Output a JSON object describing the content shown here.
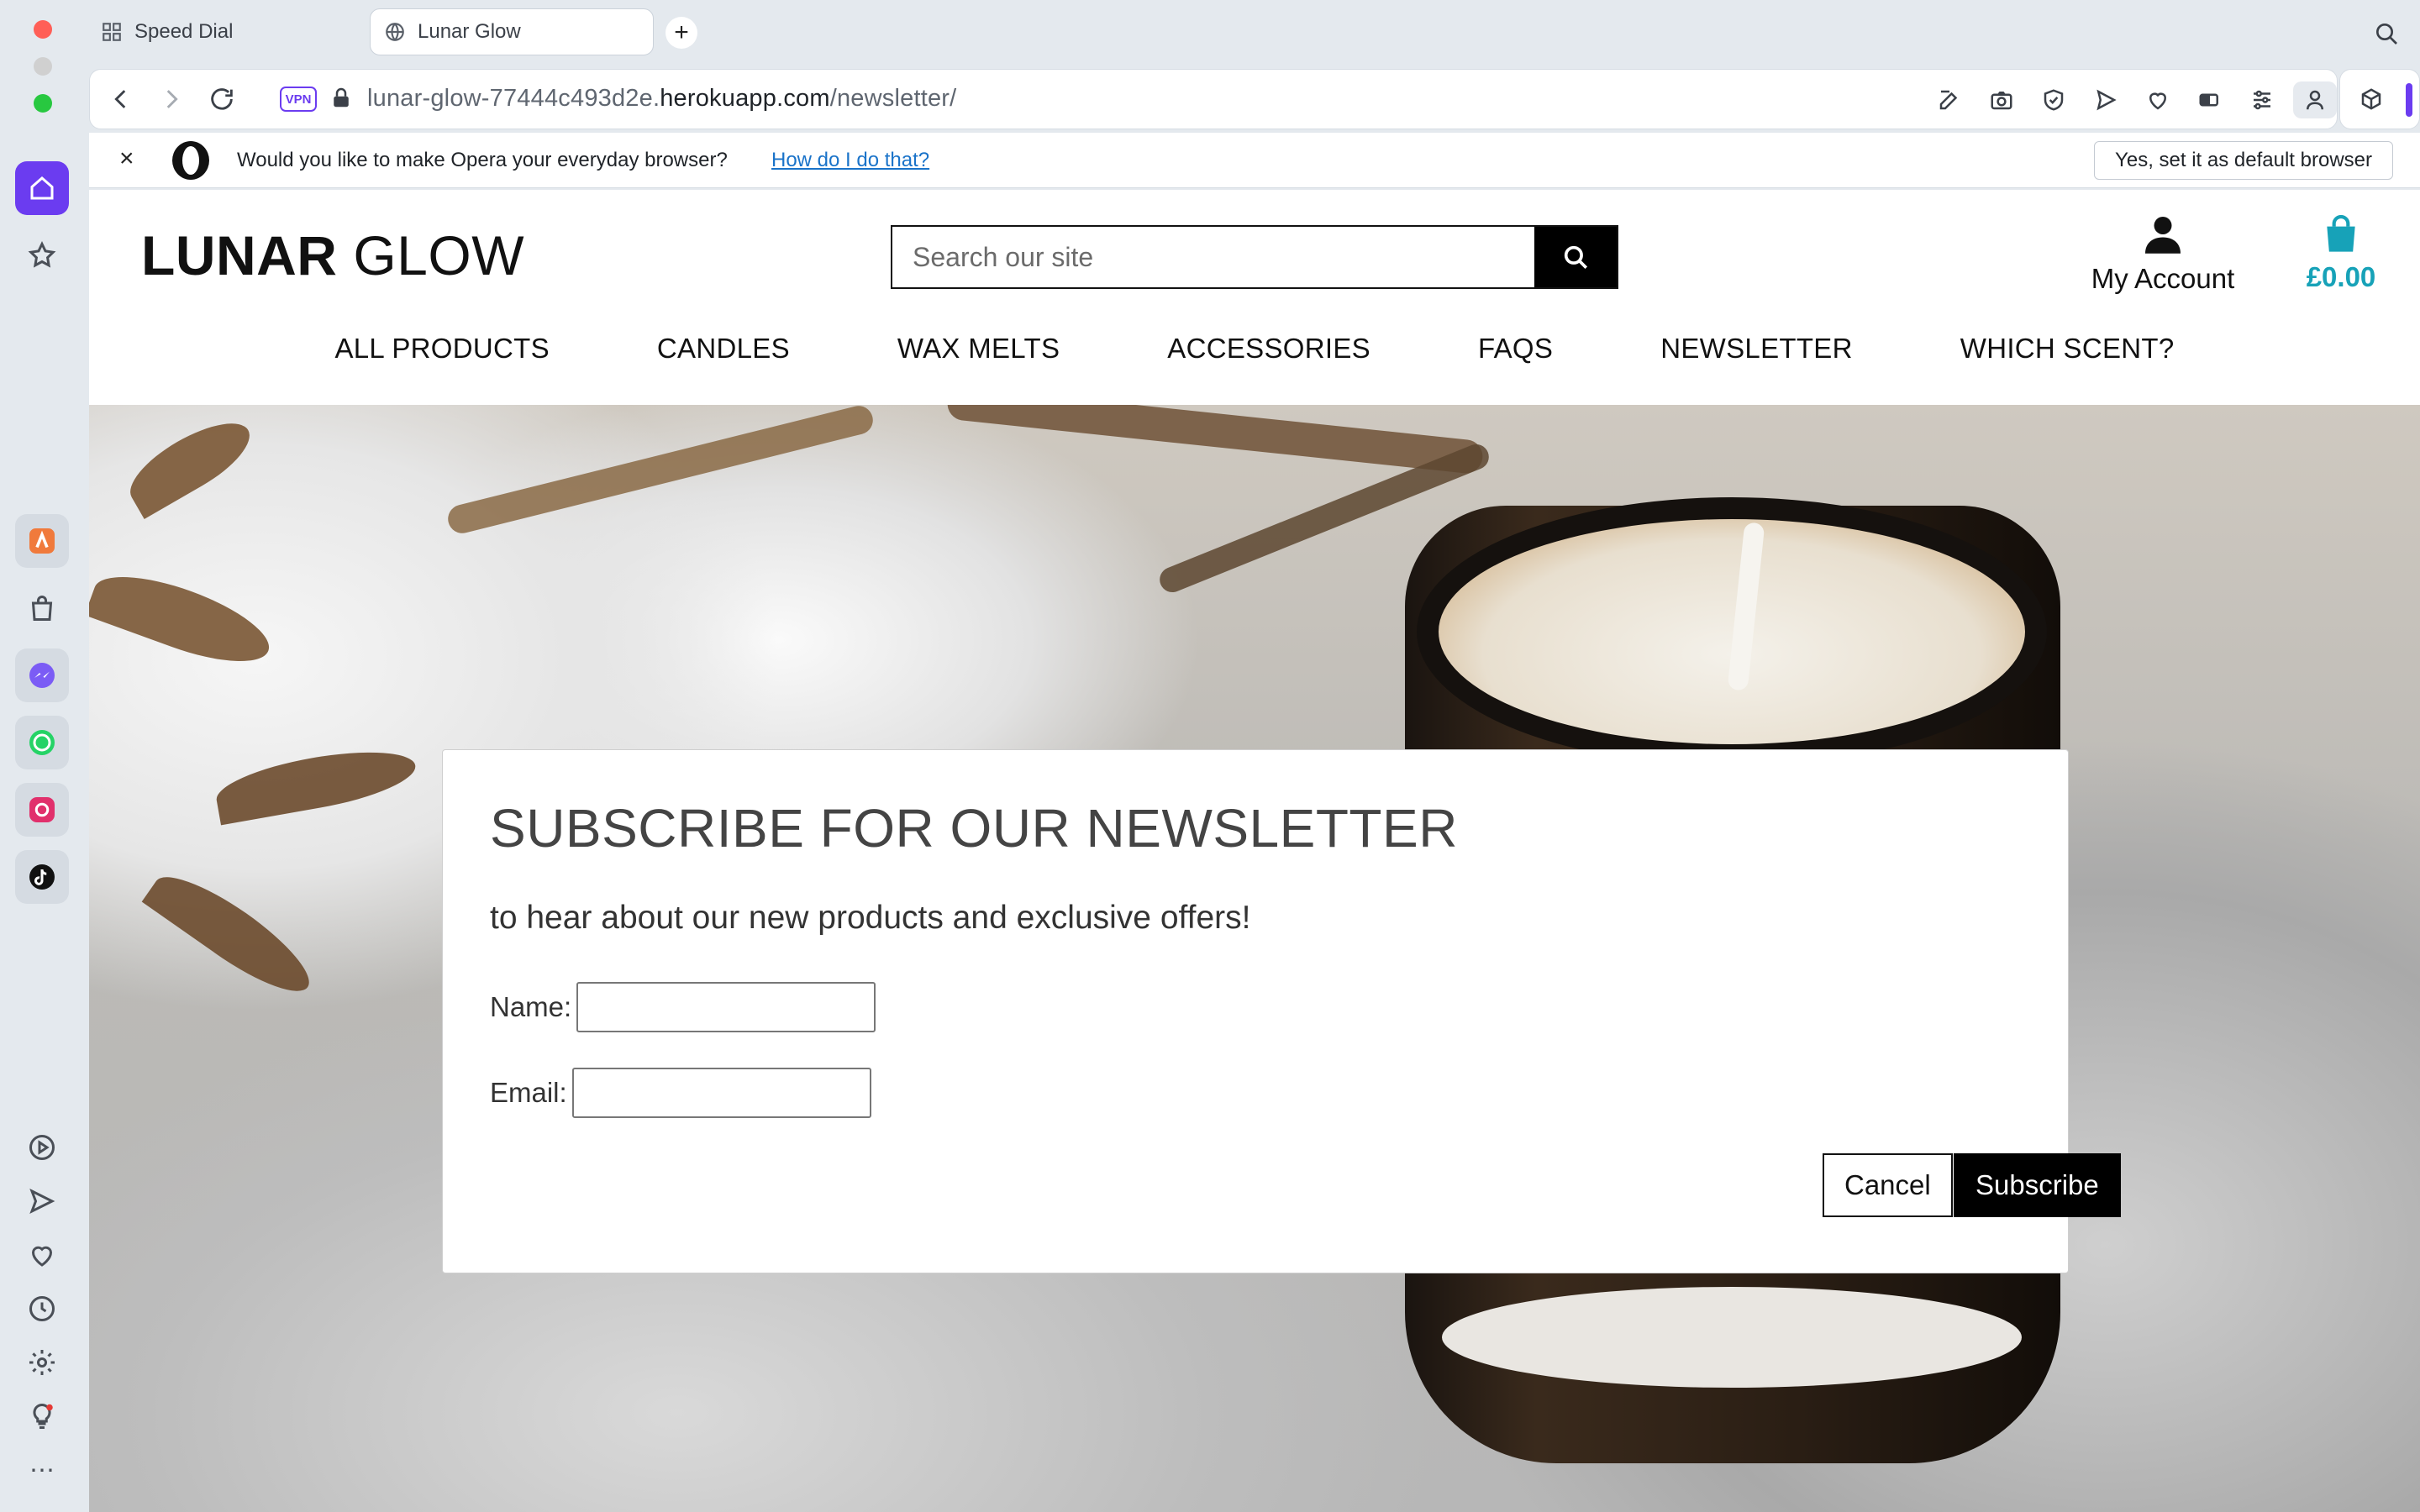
{
  "browser": {
    "tabs": [
      {
        "label": "Speed Dial",
        "active": false
      },
      {
        "label": "Lunar Glow",
        "active": true
      }
    ],
    "url": {
      "subdomain": "lunar-glow-77444c493d2e.",
      "host": "herokuapp.com",
      "path": "/newsletter/"
    },
    "vpn_label": "VPN",
    "prompt": {
      "text": "Would you like to make Opera your everyday browser?",
      "link": "How do I do that?",
      "button": "Yes, set it as default browser"
    },
    "accent": "#6b3cf0"
  },
  "site": {
    "logo_bold": "LUNAR",
    "logo_light": "GLOW",
    "search_placeholder": "Search our site",
    "account_label": "My Account",
    "cart_total": "£0.00",
    "cart_color": "#17a2b8",
    "nav": [
      "ALL PRODUCTS",
      "CANDLES",
      "WAX MELTS",
      "ACCESSORIES",
      "FAQS",
      "NEWSLETTER",
      "WHICH SCENT?"
    ]
  },
  "modal": {
    "title": "SUBSCRIBE FOR OUR NEWSLETTER",
    "subtitle": "to hear about our new products and exclusive offers!",
    "name_label": "Name:",
    "email_label": "Email:",
    "name_value": "",
    "email_value": "",
    "cancel_label": "Cancel",
    "subscribe_label": "Subscribe"
  }
}
